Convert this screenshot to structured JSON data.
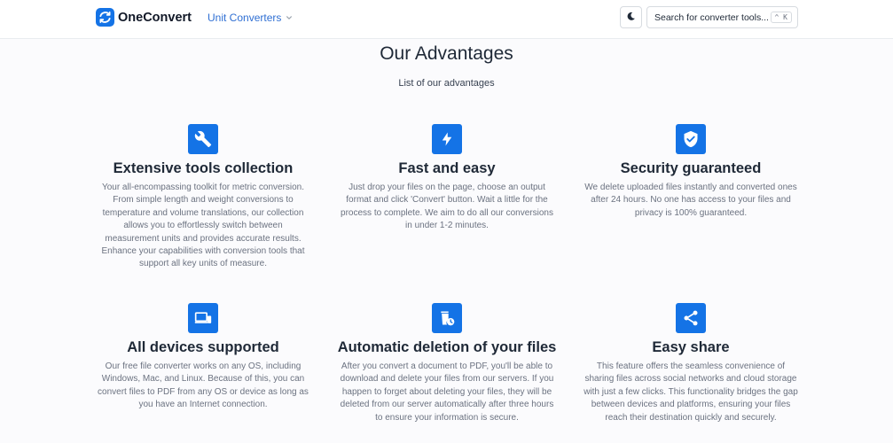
{
  "header": {
    "brand": "OneConvert",
    "nav_menu_label": "Unit Converters",
    "search_label": "Search for converter tools...",
    "search_shortcut": "^ K"
  },
  "section": {
    "title": "Our Advantages",
    "subtitle": "List of our advantages"
  },
  "features": [
    {
      "icon": "wrench-icon",
      "title": "Extensive tools collection",
      "description": "Your all-encompassing toolkit for metric conversion. From simple length and weight conversions to temperature and volume translations, our collection allows you to effortlessly switch between measurement units and provides accurate results. Enhance your capabilities with conversion tools that support all key units of measure."
    },
    {
      "icon": "lightning-icon",
      "title": "Fast and easy",
      "description": "Just drop your files on the page, choose an output format and click 'Convert' button. Wait a little for the process to complete. We aim to do all our conversions in under 1-2 minutes."
    },
    {
      "icon": "shield-check-icon",
      "title": "Security guaranteed",
      "description": "We delete uploaded files instantly and converted ones after 24 hours. No one has access to your files and privacy is 100% guaranteed."
    },
    {
      "icon": "devices-icon",
      "title": "All devices supported",
      "description": "Our free file converter works on any OS, including Windows, Mac, and Linux. Because of this, you can convert files to PDF from any OS or device as long as you have an Internet connection."
    },
    {
      "icon": "trash-clock-icon",
      "title": "Automatic deletion of your files",
      "description": "After you convert a document to PDF, you'll be able to download and delete your files from our servers. If you happen to forget about deleting your files, they will be deleted from our server automatically after three hours to ensure your information is secure."
    },
    {
      "icon": "share-icon",
      "title": "Easy share",
      "description": "This feature offers the seamless convenience of sharing files across social networks and cloud storage with just a few clicks. This functionality bridges the gap between devices and platforms, ensuring your files reach their destination quickly and securely."
    }
  ],
  "colors": {
    "accent": "#1473e6",
    "nav_link": "#2f6fd3",
    "background": "#fbfbfd"
  }
}
